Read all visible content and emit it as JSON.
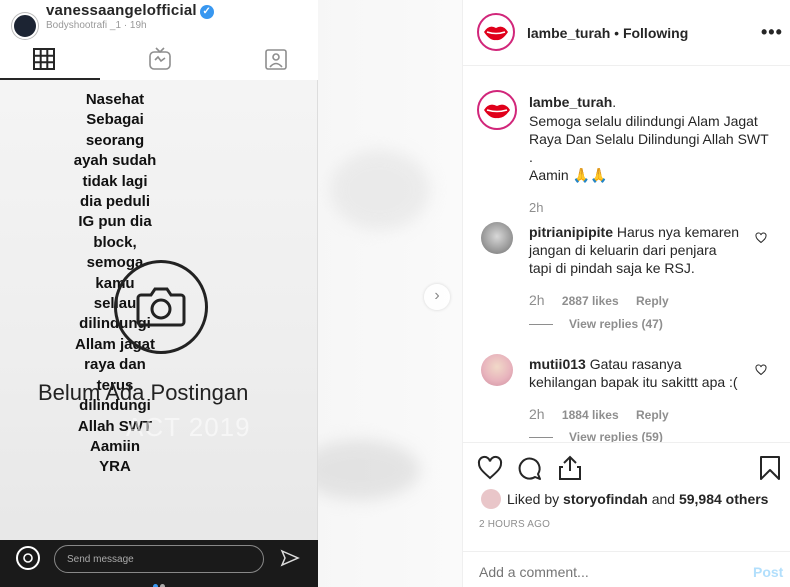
{
  "story": {
    "username": "vanessaangelofficial",
    "subtitle": "Bodyshootrafi _1 · 19h",
    "text": "Nasehat\nSebagai\nseorang\nayah sudah\ntidak lagi\ndia peduli\nIG pun dia\nblock,\nsemoga\nkamu\nsellau\ndilindungi\nAllam jagat\nraya dan\nterus\ndilindungi\nAllah SWT\nAamiin\nYRA",
    "no_posts": "Belum Ada Postingan",
    "ghost_text": "ACT 2019",
    "send_placeholder": "Send message"
  },
  "header": {
    "username": "lambe_turah",
    "separator": "•",
    "follow_status": "Following",
    "more": "•••"
  },
  "caption": {
    "username": "lambe_turah",
    "username_suffix": ".",
    "text": "Semoga selalu dilindungi Alam Jagat Raya Dan Selalu Dilindungi Allah SWT\n.\nAamin 🙏🙏",
    "time": "2h"
  },
  "comments": [
    {
      "username": "pitrianipipite",
      "text": "Harus nya kemaren jangan di keluarin dari penjara tapi di pindah saja ke RSJ.",
      "time": "2h",
      "likes": "2887 likes",
      "reply": "Reply",
      "view_replies": "View replies (47)"
    },
    {
      "username": "mutii013",
      "text": "Gatau rasanya kehilangan bapak itu sakittt apa :(",
      "time": "2h",
      "likes": "1884 likes",
      "reply": "Reply",
      "view_replies": "View replies (59)"
    }
  ],
  "likes": {
    "prefix": "Liked by",
    "user": "storyofindah",
    "conj": "and",
    "others": "59,984 others"
  },
  "timestamp": "2 HOURS AGO",
  "add_comment": {
    "placeholder": "Add a comment...",
    "post_label": "Post"
  },
  "colors": {
    "link_blue": "#3897f0",
    "post_disabled": "#b2dffc",
    "muted": "#8e8e8e",
    "avatar_ring": "#d1267a",
    "lips": "#e0001b"
  },
  "icons": [
    "grid-icon",
    "igtv-icon",
    "tagged-icon",
    "camera-icon",
    "send-icon",
    "chevron-right-icon",
    "heart-icon",
    "comment-icon",
    "share-icon",
    "bookmark-icon",
    "more-icon",
    "verified-icon"
  ]
}
